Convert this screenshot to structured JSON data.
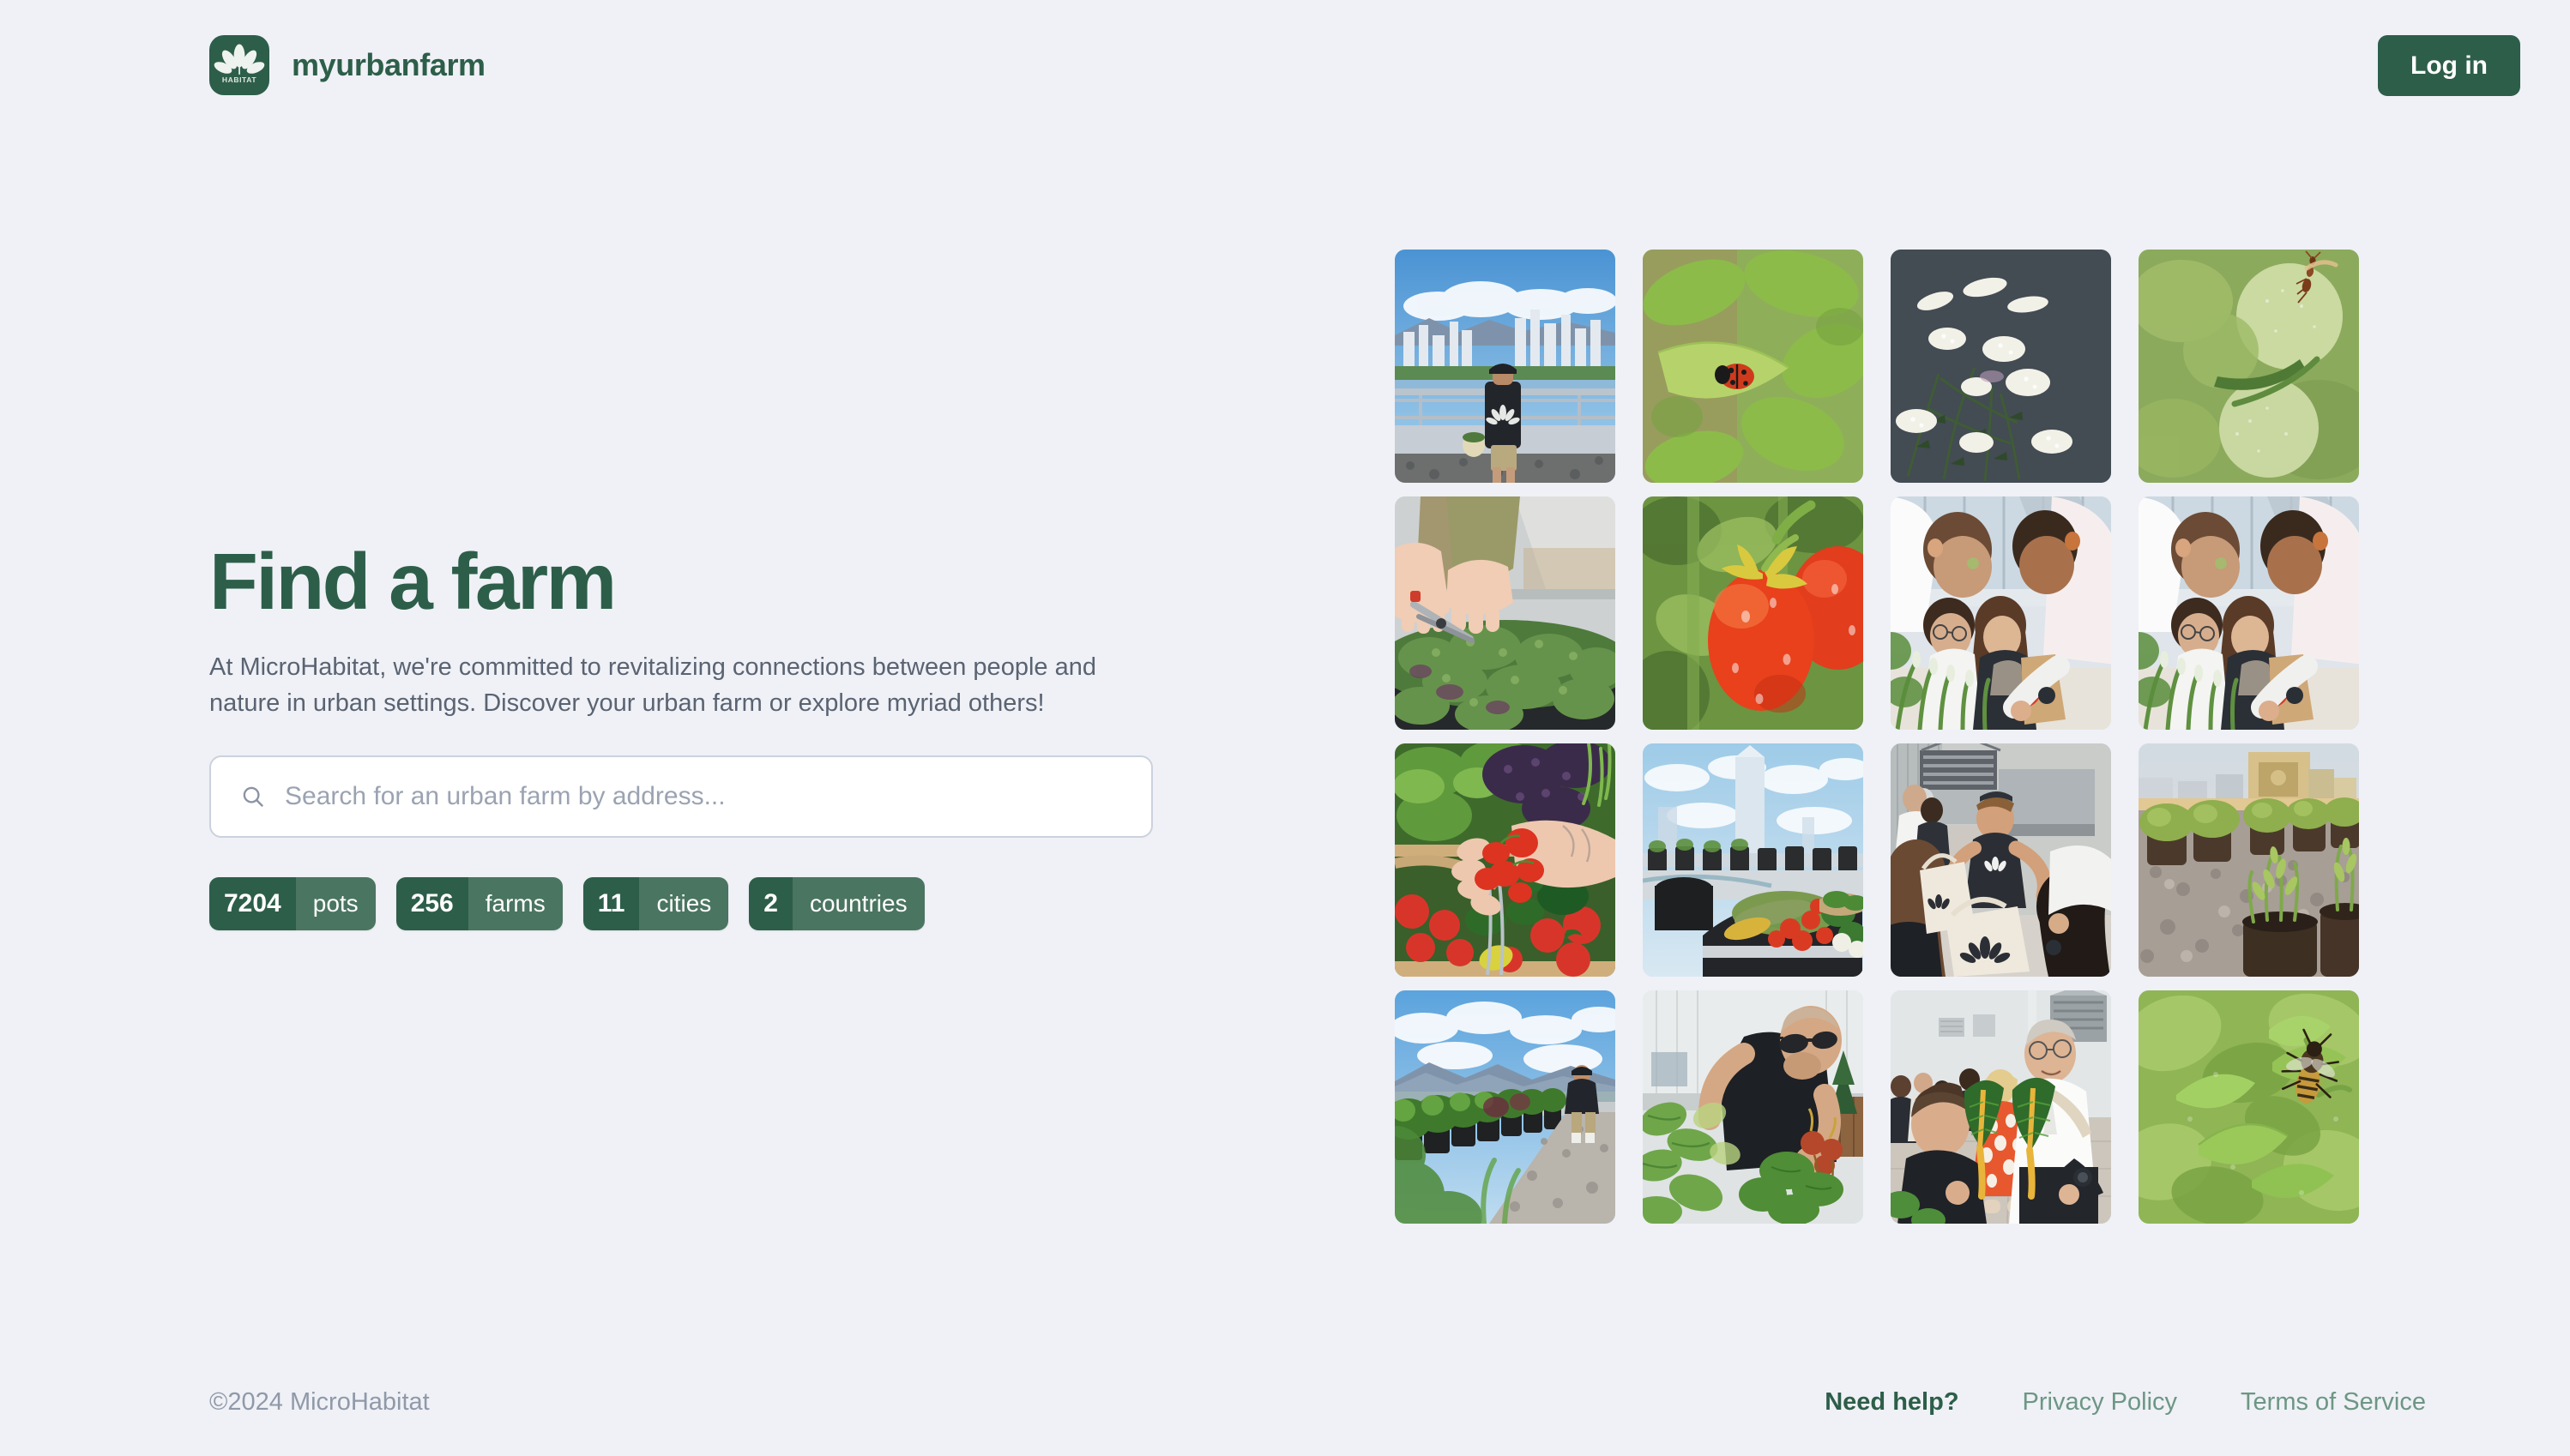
{
  "header": {
    "brand_name": "myurbanfarm",
    "logo_icon": "habitat-leaf-logo",
    "logo_wordmark": "HABITAT",
    "login_label": "Log in"
  },
  "hero": {
    "title": "Find a farm",
    "subtitle": "At MicroHabitat, we're committed to revitalizing connections between people and nature in urban settings. Discover your urban farm or explore myriad others!",
    "search": {
      "icon": "search-icon",
      "value": "",
      "placeholder": "Search for an urban farm by address..."
    },
    "stats": [
      {
        "value": "7204",
        "label": "pots"
      },
      {
        "value": "256",
        "label": "farms"
      },
      {
        "value": "11",
        "label": "cities"
      },
      {
        "value": "2",
        "label": "countries"
      }
    ]
  },
  "gallery": {
    "columns": 4,
    "rows": 4,
    "tiles": [
      {
        "id": "tile-1",
        "alt": "Farmer with backpack on rooftop overlooking city skyline"
      },
      {
        "id": "tile-2",
        "alt": "Ladybug resting on a green leaf"
      },
      {
        "id": "tile-3",
        "alt": "White yarrow flowers against dark background"
      },
      {
        "id": "tile-4",
        "alt": "Ant walking on unripe green tomatoes"
      },
      {
        "id": "tile-5",
        "alt": "Hands pruning herbs with garden shears"
      },
      {
        "id": "tile-6",
        "alt": "Ripe red roma tomatoes on the vine"
      },
      {
        "id": "tile-7",
        "alt": "Four people bending over a garden planter"
      },
      {
        "id": "tile-8",
        "alt": "Four people bending over a garden planter"
      },
      {
        "id": "tile-9",
        "alt": "Hand holding cherry tomatoes over a vegetable basket"
      },
      {
        "id": "tile-10",
        "alt": "Harvested vegetables on a rooftop planter with skyline"
      },
      {
        "id": "tile-11",
        "alt": "People exchanging canvas tote bags at a farm event"
      },
      {
        "id": "tile-12",
        "alt": "Rooftop garden of fabric pots on gravel"
      },
      {
        "id": "tile-13",
        "alt": "Rows of rooftop planters with mountains in distance"
      },
      {
        "id": "tile-14",
        "alt": "Man in sunglasses harvesting beets"
      },
      {
        "id": "tile-15",
        "alt": "Two people smiling holding swiss chard"
      },
      {
        "id": "tile-16",
        "alt": "Bee on green leaves"
      }
    ]
  },
  "footer": {
    "copyright": "©2024 MicroHabitat",
    "links": [
      {
        "label": "Need help?",
        "emphasis": true
      },
      {
        "label": "Privacy Policy",
        "emphasis": false
      },
      {
        "label": "Terms of Service",
        "emphasis": false
      }
    ]
  },
  "colors": {
    "background": "#eff1f6",
    "brand_green": "#2d5e49",
    "brand_green_light": "#4a7561",
    "footer_link": "#6d9684",
    "body_text": "#5a6372",
    "muted_text": "#9099a8",
    "input_border": "#cbd2dd",
    "placeholder": "#9ba3b2"
  }
}
